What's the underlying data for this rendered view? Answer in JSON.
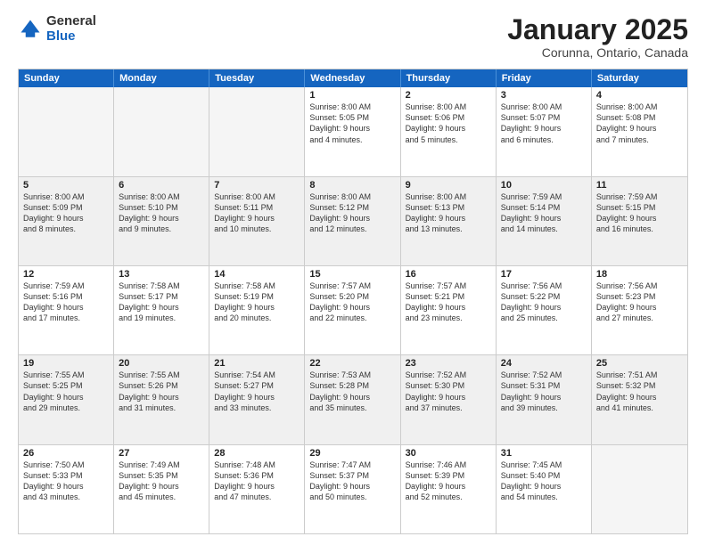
{
  "logo": {
    "general": "General",
    "blue": "Blue"
  },
  "header": {
    "month": "January 2025",
    "location": "Corunna, Ontario, Canada"
  },
  "weekdays": [
    "Sunday",
    "Monday",
    "Tuesday",
    "Wednesday",
    "Thursday",
    "Friday",
    "Saturday"
  ],
  "rows": [
    [
      {
        "day": "",
        "empty": true
      },
      {
        "day": "",
        "empty": true
      },
      {
        "day": "",
        "empty": true
      },
      {
        "day": "1",
        "lines": [
          "Sunrise: 8:00 AM",
          "Sunset: 5:05 PM",
          "Daylight: 9 hours",
          "and 4 minutes."
        ]
      },
      {
        "day": "2",
        "lines": [
          "Sunrise: 8:00 AM",
          "Sunset: 5:06 PM",
          "Daylight: 9 hours",
          "and 5 minutes."
        ]
      },
      {
        "day": "3",
        "lines": [
          "Sunrise: 8:00 AM",
          "Sunset: 5:07 PM",
          "Daylight: 9 hours",
          "and 6 minutes."
        ]
      },
      {
        "day": "4",
        "lines": [
          "Sunrise: 8:00 AM",
          "Sunset: 5:08 PM",
          "Daylight: 9 hours",
          "and 7 minutes."
        ]
      }
    ],
    [
      {
        "day": "5",
        "lines": [
          "Sunrise: 8:00 AM",
          "Sunset: 5:09 PM",
          "Daylight: 9 hours",
          "and 8 minutes."
        ]
      },
      {
        "day": "6",
        "lines": [
          "Sunrise: 8:00 AM",
          "Sunset: 5:10 PM",
          "Daylight: 9 hours",
          "and 9 minutes."
        ]
      },
      {
        "day": "7",
        "lines": [
          "Sunrise: 8:00 AM",
          "Sunset: 5:11 PM",
          "Daylight: 9 hours",
          "and 10 minutes."
        ]
      },
      {
        "day": "8",
        "lines": [
          "Sunrise: 8:00 AM",
          "Sunset: 5:12 PM",
          "Daylight: 9 hours",
          "and 12 minutes."
        ]
      },
      {
        "day": "9",
        "lines": [
          "Sunrise: 8:00 AM",
          "Sunset: 5:13 PM",
          "Daylight: 9 hours",
          "and 13 minutes."
        ]
      },
      {
        "day": "10",
        "lines": [
          "Sunrise: 7:59 AM",
          "Sunset: 5:14 PM",
          "Daylight: 9 hours",
          "and 14 minutes."
        ]
      },
      {
        "day": "11",
        "lines": [
          "Sunrise: 7:59 AM",
          "Sunset: 5:15 PM",
          "Daylight: 9 hours",
          "and 16 minutes."
        ]
      }
    ],
    [
      {
        "day": "12",
        "lines": [
          "Sunrise: 7:59 AM",
          "Sunset: 5:16 PM",
          "Daylight: 9 hours",
          "and 17 minutes."
        ]
      },
      {
        "day": "13",
        "lines": [
          "Sunrise: 7:58 AM",
          "Sunset: 5:17 PM",
          "Daylight: 9 hours",
          "and 19 minutes."
        ]
      },
      {
        "day": "14",
        "lines": [
          "Sunrise: 7:58 AM",
          "Sunset: 5:19 PM",
          "Daylight: 9 hours",
          "and 20 minutes."
        ]
      },
      {
        "day": "15",
        "lines": [
          "Sunrise: 7:57 AM",
          "Sunset: 5:20 PM",
          "Daylight: 9 hours",
          "and 22 minutes."
        ]
      },
      {
        "day": "16",
        "lines": [
          "Sunrise: 7:57 AM",
          "Sunset: 5:21 PM",
          "Daylight: 9 hours",
          "and 23 minutes."
        ]
      },
      {
        "day": "17",
        "lines": [
          "Sunrise: 7:56 AM",
          "Sunset: 5:22 PM",
          "Daylight: 9 hours",
          "and 25 minutes."
        ]
      },
      {
        "day": "18",
        "lines": [
          "Sunrise: 7:56 AM",
          "Sunset: 5:23 PM",
          "Daylight: 9 hours",
          "and 27 minutes."
        ]
      }
    ],
    [
      {
        "day": "19",
        "lines": [
          "Sunrise: 7:55 AM",
          "Sunset: 5:25 PM",
          "Daylight: 9 hours",
          "and 29 minutes."
        ]
      },
      {
        "day": "20",
        "lines": [
          "Sunrise: 7:55 AM",
          "Sunset: 5:26 PM",
          "Daylight: 9 hours",
          "and 31 minutes."
        ]
      },
      {
        "day": "21",
        "lines": [
          "Sunrise: 7:54 AM",
          "Sunset: 5:27 PM",
          "Daylight: 9 hours",
          "and 33 minutes."
        ]
      },
      {
        "day": "22",
        "lines": [
          "Sunrise: 7:53 AM",
          "Sunset: 5:28 PM",
          "Daylight: 9 hours",
          "and 35 minutes."
        ]
      },
      {
        "day": "23",
        "lines": [
          "Sunrise: 7:52 AM",
          "Sunset: 5:30 PM",
          "Daylight: 9 hours",
          "and 37 minutes."
        ]
      },
      {
        "day": "24",
        "lines": [
          "Sunrise: 7:52 AM",
          "Sunset: 5:31 PM",
          "Daylight: 9 hours",
          "and 39 minutes."
        ]
      },
      {
        "day": "25",
        "lines": [
          "Sunrise: 7:51 AM",
          "Sunset: 5:32 PM",
          "Daylight: 9 hours",
          "and 41 minutes."
        ]
      }
    ],
    [
      {
        "day": "26",
        "lines": [
          "Sunrise: 7:50 AM",
          "Sunset: 5:33 PM",
          "Daylight: 9 hours",
          "and 43 minutes."
        ]
      },
      {
        "day": "27",
        "lines": [
          "Sunrise: 7:49 AM",
          "Sunset: 5:35 PM",
          "Daylight: 9 hours",
          "and 45 minutes."
        ]
      },
      {
        "day": "28",
        "lines": [
          "Sunrise: 7:48 AM",
          "Sunset: 5:36 PM",
          "Daylight: 9 hours",
          "and 47 minutes."
        ]
      },
      {
        "day": "29",
        "lines": [
          "Sunrise: 7:47 AM",
          "Sunset: 5:37 PM",
          "Daylight: 9 hours",
          "and 50 minutes."
        ]
      },
      {
        "day": "30",
        "lines": [
          "Sunrise: 7:46 AM",
          "Sunset: 5:39 PM",
          "Daylight: 9 hours",
          "and 52 minutes."
        ]
      },
      {
        "day": "31",
        "lines": [
          "Sunrise: 7:45 AM",
          "Sunset: 5:40 PM",
          "Daylight: 9 hours",
          "and 54 minutes."
        ]
      },
      {
        "day": "",
        "empty": true
      }
    ]
  ]
}
